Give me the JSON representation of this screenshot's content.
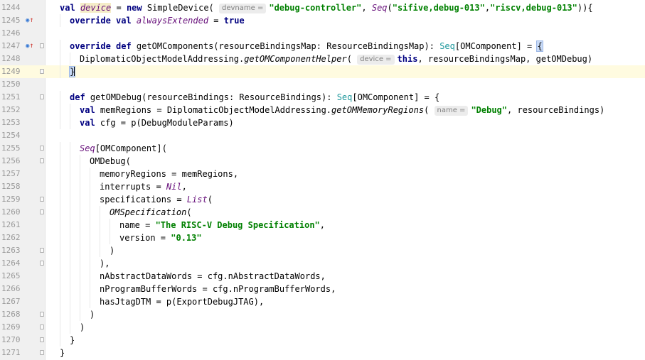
{
  "editor": {
    "lines": [
      {
        "num": "1244",
        "indent": 1,
        "segs": [
          [
            "kw",
            "val "
          ],
          [
            "field",
            "device"
          ],
          [
            "def",
            " = "
          ],
          [
            "kw",
            "new "
          ],
          [
            "def",
            "SimpleDevice( "
          ],
          [
            "hint",
            "devname ="
          ],
          [
            "str",
            "\"debug-controller\""
          ],
          [
            "def",
            ", "
          ],
          [
            "ital",
            "Seq"
          ],
          [
            "def",
            "("
          ],
          [
            "str",
            "\"sifive,debug-013\""
          ],
          [
            "def",
            ","
          ],
          [
            "str",
            "\"riscv,debug-013\""
          ],
          [
            "def",
            "))"
          ],
          [
            "def",
            "{"
          ]
        ]
      },
      {
        "num": "1245",
        "indent": 2,
        "marker": "override",
        "segs": [
          [
            "kw",
            "override val "
          ],
          [
            "ital",
            "alwaysExtended"
          ],
          [
            "def",
            " = "
          ],
          [
            "kw",
            "true"
          ]
        ]
      },
      {
        "num": "1246",
        "indent": 0,
        "segs": []
      },
      {
        "num": "1247",
        "indent": 2,
        "marker": "override",
        "fold": true,
        "segs": [
          [
            "kw",
            "override def "
          ],
          [
            "def",
            "getOMComponents(resourceBindingsMap: ResourceBindingsMap): "
          ],
          [
            "type",
            "Seq"
          ],
          [
            "def",
            "[OMComponent] = "
          ],
          [
            "brace",
            "{"
          ]
        ]
      },
      {
        "num": "1248",
        "indent": 3,
        "segs": [
          [
            "def",
            "DiplomaticObjectModelAddressing."
          ],
          [
            "itfn",
            "getOMComponentHelper"
          ],
          [
            "def",
            "( "
          ],
          [
            "hint",
            "device ="
          ],
          [
            "kw",
            "this"
          ],
          [
            "def",
            ", resourceBindingsMap, getOMDebug)"
          ]
        ]
      },
      {
        "num": "1249",
        "indent": 2,
        "current": true,
        "fold": true,
        "segs": [
          [
            "brace",
            "}"
          ]
        ]
      },
      {
        "num": "1250",
        "indent": 0,
        "segs": []
      },
      {
        "num": "1251",
        "indent": 2,
        "fold": true,
        "segs": [
          [
            "kw",
            "def "
          ],
          [
            "def",
            "getOMDebug(resourceBindings: ResourceBindings): "
          ],
          [
            "type",
            "Seq"
          ],
          [
            "def",
            "[OMComponent] = {"
          ]
        ]
      },
      {
        "num": "1252",
        "indent": 3,
        "segs": [
          [
            "kw",
            "val "
          ],
          [
            "def",
            "memRegions = DiplomaticObjectModelAddressing."
          ],
          [
            "itfn",
            "getOMMemoryRegions"
          ],
          [
            "def",
            "( "
          ],
          [
            "hint",
            "name ="
          ],
          [
            "str",
            "\"Debug\""
          ],
          [
            "def",
            ", resourceBindings)"
          ]
        ]
      },
      {
        "num": "1253",
        "indent": 3,
        "segs": [
          [
            "kw",
            "val "
          ],
          [
            "def",
            "cfg = p(DebugModuleParams)"
          ]
        ]
      },
      {
        "num": "1254",
        "indent": 0,
        "segs": []
      },
      {
        "num": "1255",
        "indent": 3,
        "fold": true,
        "segs": [
          [
            "ital",
            "Seq"
          ],
          [
            "def",
            "[OMComponent]("
          ]
        ]
      },
      {
        "num": "1256",
        "indent": 4,
        "fold": true,
        "segs": [
          [
            "def",
            "OMDebug("
          ]
        ]
      },
      {
        "num": "1257",
        "indent": 5,
        "segs": [
          [
            "def",
            "memoryRegions = memRegions,"
          ]
        ]
      },
      {
        "num": "1258",
        "indent": 5,
        "segs": [
          [
            "def",
            "interrupts = "
          ],
          [
            "ital",
            "Nil"
          ],
          [
            "def",
            ","
          ]
        ]
      },
      {
        "num": "1259",
        "indent": 5,
        "fold": true,
        "segs": [
          [
            "def",
            "specifications = "
          ],
          [
            "ital",
            "List"
          ],
          [
            "def",
            "("
          ]
        ]
      },
      {
        "num": "1260",
        "indent": 6,
        "fold": true,
        "segs": [
          [
            "itfn",
            "OMSpecification"
          ],
          [
            "def",
            "("
          ]
        ]
      },
      {
        "num": "1261",
        "indent": 7,
        "segs": [
          [
            "def",
            "name = "
          ],
          [
            "str",
            "\"The RISC-V Debug Specification\""
          ],
          [
            "def",
            ","
          ]
        ]
      },
      {
        "num": "1262",
        "indent": 7,
        "segs": [
          [
            "def",
            "version = "
          ],
          [
            "str",
            "\"0.13\""
          ]
        ]
      },
      {
        "num": "1263",
        "indent": 6,
        "fold": true,
        "segs": [
          [
            "def",
            ")"
          ]
        ]
      },
      {
        "num": "1264",
        "indent": 5,
        "fold": true,
        "segs": [
          [
            "def",
            "),"
          ]
        ]
      },
      {
        "num": "1265",
        "indent": 5,
        "segs": [
          [
            "def",
            "nAbstractDataWords = cfg.nAbstractDataWords,"
          ]
        ]
      },
      {
        "num": "1266",
        "indent": 5,
        "segs": [
          [
            "def",
            "nProgramBufferWords = cfg.nProgramBufferWords,"
          ]
        ]
      },
      {
        "num": "1267",
        "indent": 5,
        "segs": [
          [
            "def",
            "hasJtagDTM = p(ExportDebugJTAG),"
          ]
        ]
      },
      {
        "num": "1268",
        "indent": 4,
        "fold": true,
        "segs": [
          [
            "def",
            ")"
          ]
        ]
      },
      {
        "num": "1269",
        "indent": 3,
        "fold": true,
        "segs": [
          [
            "def",
            ")"
          ]
        ]
      },
      {
        "num": "1270",
        "indent": 2,
        "fold": true,
        "segs": [
          [
            "def",
            "}"
          ]
        ]
      },
      {
        "num": "1271",
        "indent": 1,
        "fold": true,
        "segs": [
          [
            "def",
            "}"
          ]
        ]
      }
    ]
  },
  "icons": {
    "override_marker": "override-up-arrow-icon",
    "fold": "fold-toggle-icon"
  },
  "colors": {
    "keyword": "#000080",
    "string": "#008000",
    "type": "#20999d",
    "current_line": "#fffbe0"
  }
}
